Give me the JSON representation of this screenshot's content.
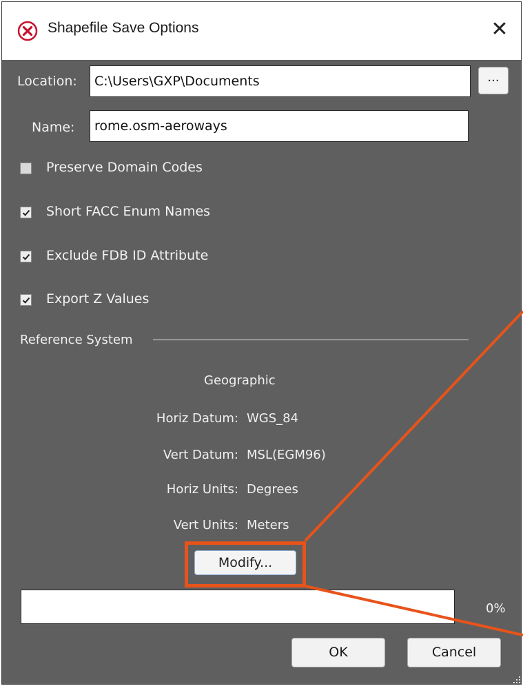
{
  "window": {
    "title": "Shapefile Save Options",
    "close_glyph": "✕",
    "title_icon": "error-circle-icon"
  },
  "location": {
    "label": "Location:",
    "value": "C:\\Users\\GXP\\Documents",
    "browse_label": "..."
  },
  "name": {
    "label": "Name:",
    "value": "rome.osm-aeroways"
  },
  "options": [
    {
      "label": "Preserve Domain Codes",
      "checked": false
    },
    {
      "label": "Short FACC Enum Names",
      "checked": true
    },
    {
      "label": "Exclude FDB ID Attribute",
      "checked": true
    },
    {
      "label": "Export Z Values",
      "checked": true
    }
  ],
  "reference_system": {
    "section_label": "Reference System",
    "type": "Geographic",
    "rows": [
      {
        "key": "Horiz Datum:",
        "value": "WGS_84"
      },
      {
        "key": "Vert Datum:",
        "value": "MSL(EGM96)"
      },
      {
        "key": "Horiz Units:",
        "value": "Degrees"
      },
      {
        "key": "Vert Units:",
        "value": "Meters"
      }
    ],
    "modify_label": "Modify..."
  },
  "progress": {
    "fraction": 0,
    "text": "0%"
  },
  "buttons": {
    "ok": "OK",
    "cancel": "Cancel"
  },
  "colors": {
    "dialog_bg": "#5f5f5f",
    "highlight": "#e8531a",
    "title_icon": "#c8102e"
  }
}
